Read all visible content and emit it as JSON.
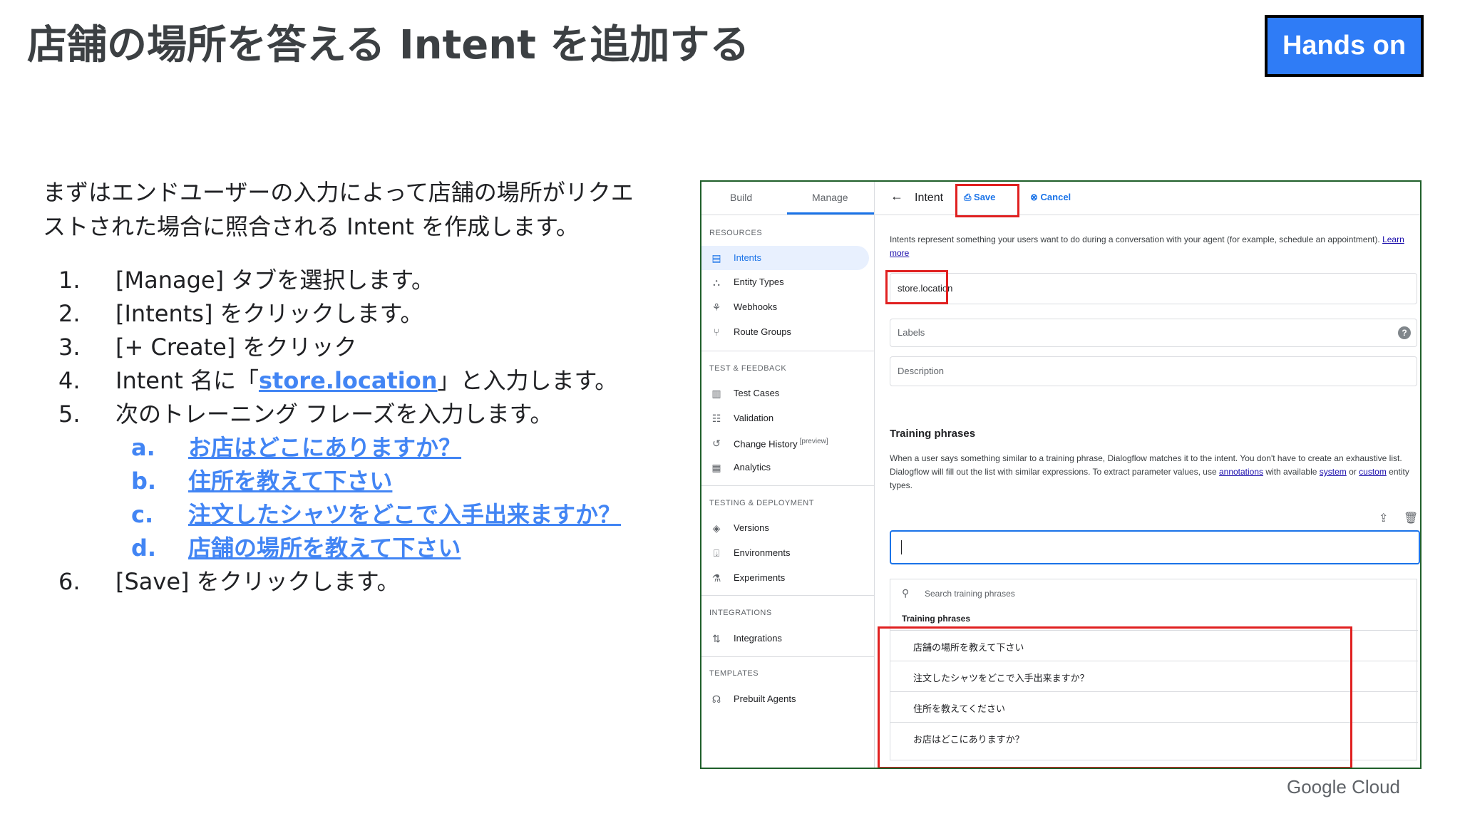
{
  "slide": {
    "title": "店舗の場所を答える Intent を追加する",
    "badge": "Hands on",
    "intro": "まずはエンドユーザーの入力によって店舗の場所がリクエストされた場合に照合される Intent を作成します。",
    "steps": [
      {
        "num": "1.",
        "text": "[Manage] タブを選択します。"
      },
      {
        "num": "2.",
        "text": "[Intents] をクリックします。"
      },
      {
        "num": "3.",
        "text": "[+ Create] をクリック"
      },
      {
        "num": "4.",
        "pre": "Intent 名に「",
        "link": "store.location",
        "post": "」と入力します。"
      },
      {
        "num": "5.",
        "text": "次のトレーニング フレーズを入力します。"
      },
      {
        "num": "6.",
        "text": "[Save] をクリックします。"
      }
    ],
    "phrases": [
      {
        "letter": "a.",
        "text": "お店はどこにありますか？"
      },
      {
        "letter": "b.",
        "text": "住所を教えて下さい"
      },
      {
        "letter": "c.",
        "text": "注文したシャツをどこで入手出来ますか？"
      },
      {
        "letter": "d.",
        "text": "店舗の場所を教えて下さい"
      }
    ],
    "footer_brand": "Google Cloud"
  },
  "console": {
    "tabs": [
      "Build",
      "Manage"
    ],
    "sections": {
      "resources": "RESOURCES",
      "test_feedback": "TEST & FEEDBACK",
      "testing_deployment": "TESTING & DEPLOYMENT",
      "integrations": "INTEGRATIONS",
      "templates": "TEMPLATES"
    },
    "nav": {
      "intents": "Intents",
      "entity_types": "Entity Types",
      "webhooks": "Webhooks",
      "route_groups": "Route Groups",
      "test_cases": "Test Cases",
      "validation": "Validation",
      "change_history": "Change History",
      "preview_tag": "[preview]",
      "analytics": "Analytics",
      "versions": "Versions",
      "environments": "Environments",
      "experiments": "Experiments",
      "integrations": "Integrations",
      "prebuilt_agents": "Prebuilt Agents"
    },
    "topbar": {
      "title": "Intent",
      "save": "Save",
      "cancel": "Cancel"
    },
    "description": {
      "text": "Intents represent something your users want to do during a conversation with your agent (for example, schedule an appointment).",
      "link": "Learn more"
    },
    "display_name_value": "store.location",
    "labels_placeholder": "Labels",
    "description_placeholder": "Description",
    "training": {
      "heading": "Training phrases",
      "desc_1": "When a user says something similar to a training phrase, Dialogflow matches it to the intent. You don't have to create an exhaustive list. Dialogflow will fill out the list with similar expressions. To extract parameter values, use",
      "link_annotations": "annotations",
      "desc_2": "with available",
      "link_system": "system",
      "desc_3": "or",
      "link_custom": "custom",
      "desc_4": "entity types.",
      "search_placeholder": "Search training phrases",
      "list_header": "Training phrases",
      "phrases": [
        "店舗の場所を教えて下さい",
        "注文したシャツをどこで入手出来ますか？",
        "住所を教えてください",
        "お店はどこにありますか？"
      ]
    }
  },
  "colors": {
    "accent": "#1a73e8",
    "highlight_red": "#e02020",
    "badge_blue": "#2f7cf6",
    "link_blue": "#4285f4"
  }
}
